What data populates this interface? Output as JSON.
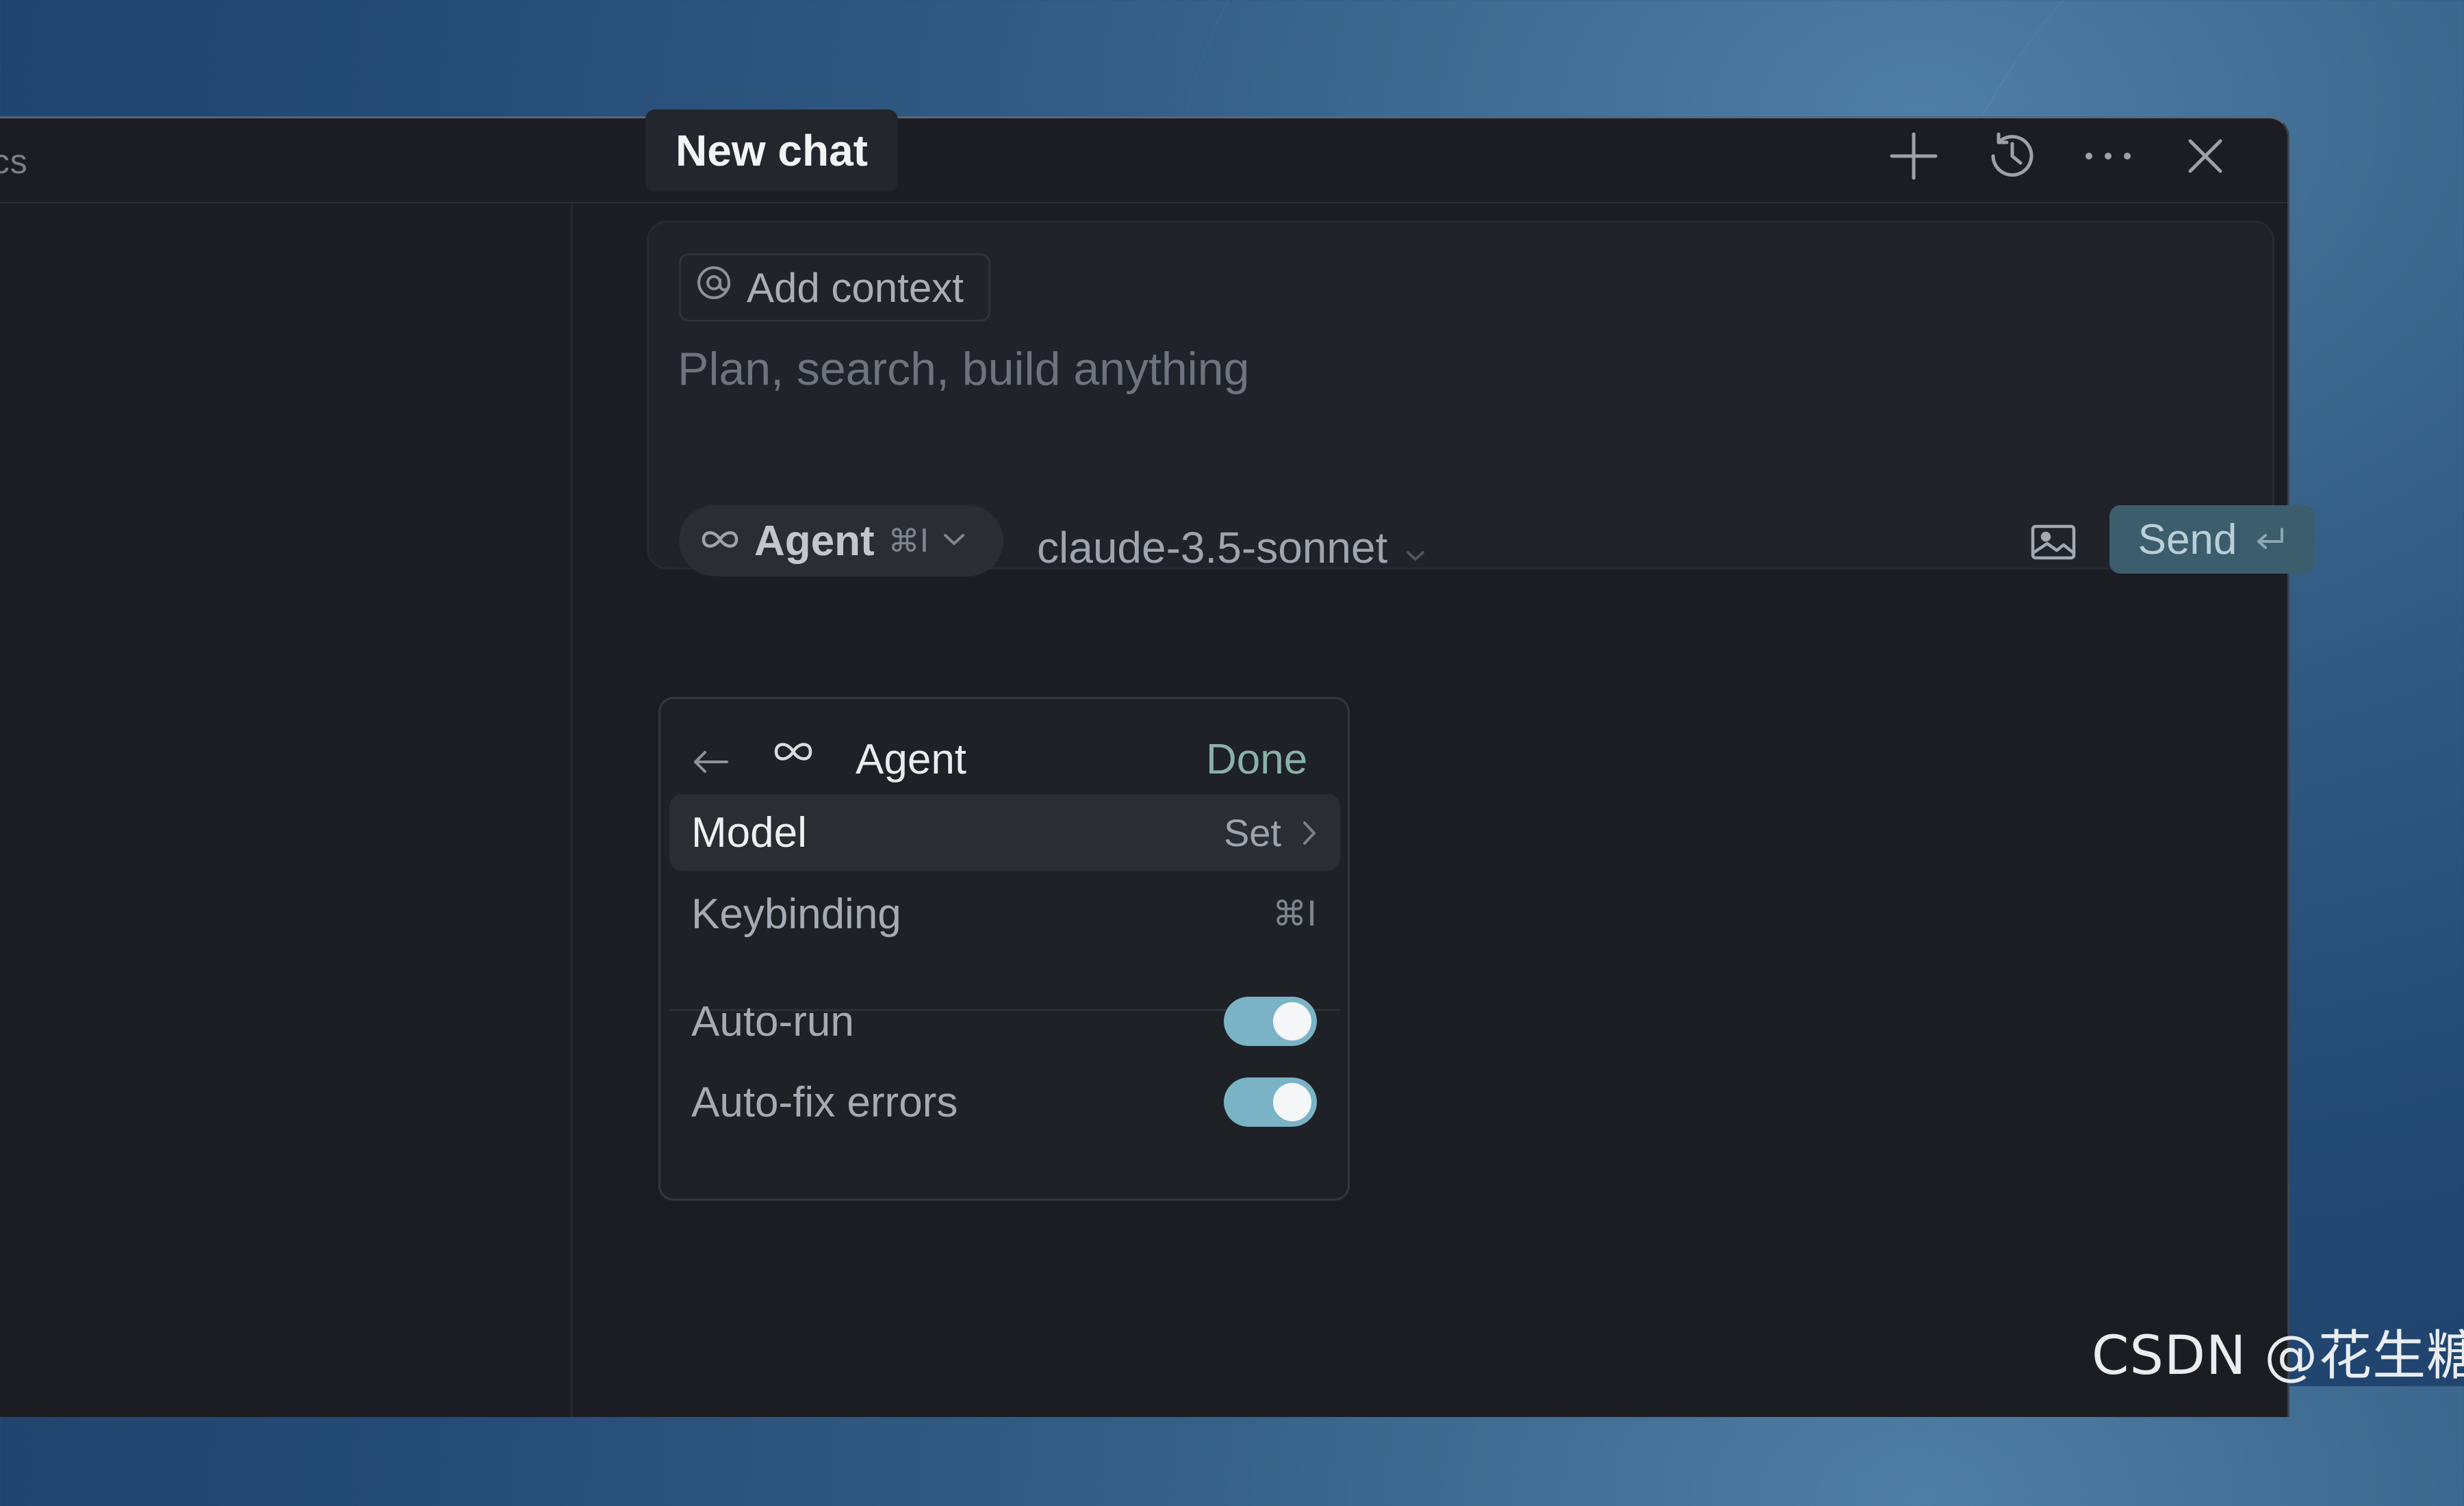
{
  "window": {
    "title_fragment": "ocs"
  },
  "chat": {
    "title": "New chat",
    "header_icons": [
      "plus-icon",
      "history-icon",
      "more-icon",
      "close-icon"
    ]
  },
  "composer": {
    "add_context_label": "Add context",
    "add_context_icon": "at-icon",
    "placeholder": "Plan, search, build anything",
    "mode_label": "Agent",
    "mode_shortcut": "⌘I",
    "model": "claude-3.5-sonnet",
    "send_label": "Send"
  },
  "agent_menu": {
    "title": "Agent",
    "done_label": "Done",
    "model_label": "Model",
    "model_value": "Set",
    "keybinding_label": "Keybinding",
    "keybinding_value": "⌘I",
    "auto_run_label": "Auto-run",
    "auto_run_on": true,
    "auto_fix_label": "Auto-fix errors",
    "auto_fix_on": true
  },
  "watermark": "CSDN @花生糖@",
  "colors": {
    "accent": "#7ab3c6",
    "done": "#8ab1a8",
    "send_bg": "#3b5d6c"
  }
}
